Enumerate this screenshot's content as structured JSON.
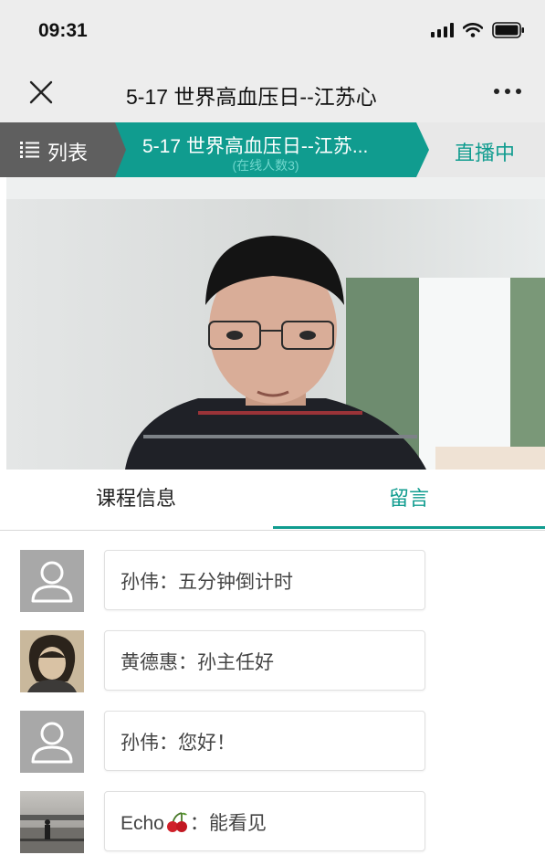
{
  "status_bar": {
    "time": "09:31"
  },
  "nav": {
    "title": "5-17 世界高血压日--江苏心",
    "close_icon": "close-icon",
    "more_icon": "more-icon"
  },
  "live_header": {
    "list_label": "列表",
    "title": "5-17 世界高血压日--江苏...",
    "online_count": "(在线人数3)",
    "status": "直播中"
  },
  "tabs": [
    {
      "label": "课程信息",
      "active": false
    },
    {
      "label": "留言",
      "active": true
    }
  ],
  "comments": [
    {
      "user": "孙伟",
      "separator": "：",
      "text": "五分钟倒计时",
      "avatar": "default-avatar-icon"
    },
    {
      "user": "黄德惠",
      "separator": "：",
      "text": "孙主任好",
      "avatar": "photo"
    },
    {
      "user": "孙伟",
      "separator": "：",
      "text": "您好！",
      "avatar": "default-avatar-icon"
    },
    {
      "user": "Echo",
      "emoji": "cherry-icon",
      "separator": "：",
      "text": "能看见",
      "avatar": "photo"
    }
  ],
  "colors": {
    "accent": "#109c8f",
    "list_tab": "#5f5f5f",
    "bar_bg": "#ededed"
  }
}
